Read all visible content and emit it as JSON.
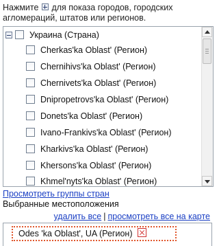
{
  "intro": {
    "text_before": "Нажмите",
    "text_after": "для показа городов, городских агломераций, штатов или регионов.",
    "icon": "plus-expand-icon"
  },
  "tree": {
    "parent": {
      "label": "Украина (Страна)",
      "checked": false,
      "expanded": true
    },
    "items": [
      {
        "label": "Cherkas'ka Oblast' (Регион)",
        "checked": false
      },
      {
        "label": "Chernihivs'ka Oblast' (Регион)",
        "checked": false
      },
      {
        "label": "Chernivets'ka Oblast' (Регион)",
        "checked": false
      },
      {
        "label": "Dnipropetrovs'ka Oblast' (Регион)",
        "checked": false
      },
      {
        "label": "Donets'ka Oblast' (Регион)",
        "checked": false
      },
      {
        "label": "Ivano-Frankivs'ka Oblast' (Регион)",
        "checked": false
      },
      {
        "label": "Kharkivs'ka Oblast' (Регион)",
        "checked": false
      },
      {
        "label": "Khersons'ka Oblast' (Регион)",
        "checked": false
      },
      {
        "label": "Khmel'nyts'ka Oblast' (Регион)",
        "checked": false
      }
    ]
  },
  "links": {
    "view_country_groups": "Просмотреть группы стран",
    "remove_all": "удалить все",
    "separator": "|",
    "view_all_on_map": "просмотреть все на карте"
  },
  "selected": {
    "title": "Выбранные местоположения",
    "items": [
      {
        "label": "Odes 'ka Oblast', UA (Регион)",
        "remove_icon": "remove-x-icon"
      }
    ]
  },
  "colors": {
    "link": "#1a3fc4",
    "highlight_dotted": "#e0552a",
    "remove_icon": "#d03030"
  }
}
